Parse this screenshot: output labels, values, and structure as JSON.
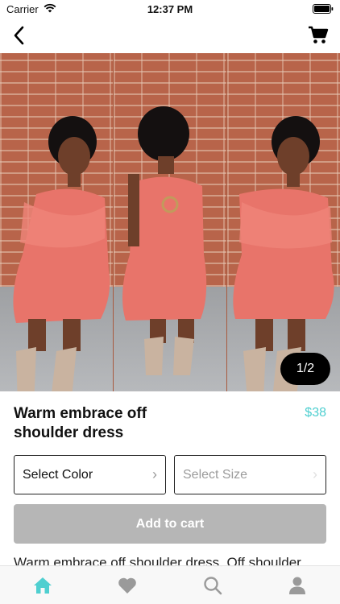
{
  "status": {
    "carrier": "Carrier",
    "time": "12:37 PM"
  },
  "gallery": {
    "counter": "1/2",
    "colors": {
      "dress": "#e8746a",
      "skin": "#6e3f2a",
      "hair": "#141010",
      "boots": "#c9b3a0"
    }
  },
  "product": {
    "title": "Warm embrace off shoulder dress",
    "price": "$38",
    "color_select": "Select Color",
    "size_select": "Select Size",
    "add_to_cart": "Add to cart",
    "description": "Warm embrace off shoulder dress. Off shoulder"
  },
  "tabs": [
    {
      "icon": "home-icon",
      "active": true
    },
    {
      "icon": "heart-icon",
      "active": false
    },
    {
      "icon": "search-icon",
      "active": false
    },
    {
      "icon": "profile-icon",
      "active": false
    }
  ],
  "colors": {
    "accent": "#4fcfd0",
    "button_disabled": "#b6b6b6",
    "tab_inactive": "#9a9a9a"
  }
}
